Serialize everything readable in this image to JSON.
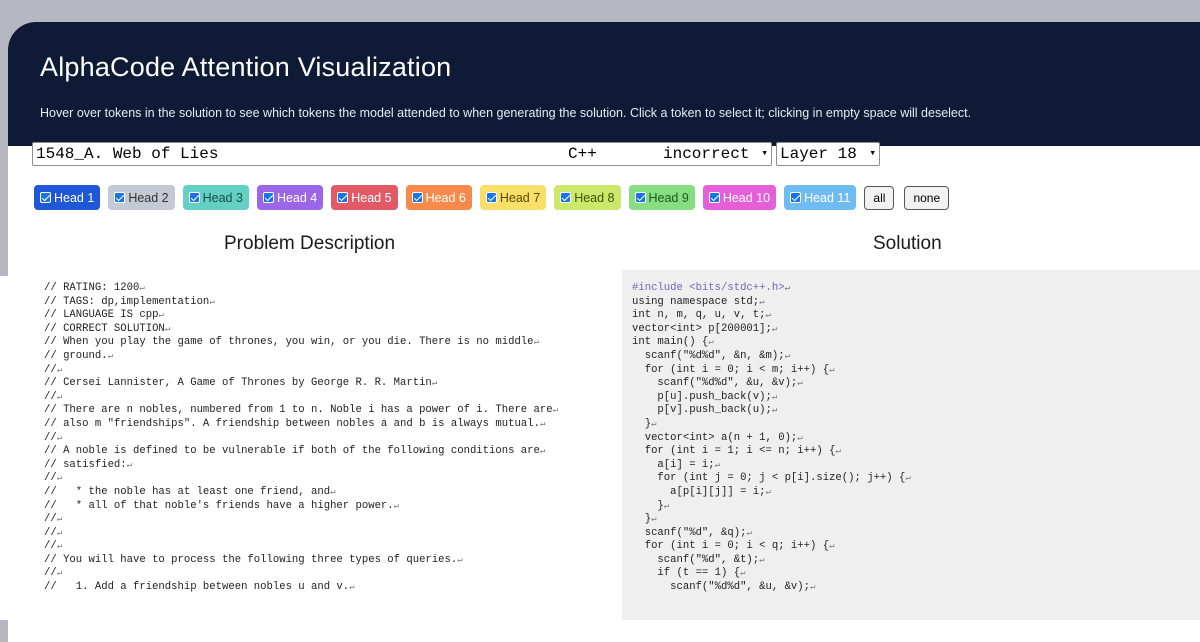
{
  "header": {
    "title": "AlphaCode Attention Visualization",
    "subtitle": "Hover over tokens in the solution to see which tokens the model attended to when generating the solution. Click a token to select it; clicking in empty space will deselect."
  },
  "problem_select": {
    "title": "1548_A. Web of Lies",
    "language": "C++",
    "status": "incorrect"
  },
  "layer_select": {
    "value": "Layer 18"
  },
  "heads": [
    {
      "label": "Head 1",
      "color": "#1f57d6",
      "text_color": "#ffffff"
    },
    {
      "label": "Head 2",
      "color": "#c4c9d4",
      "text_color": "#333333"
    },
    {
      "label": "Head 3",
      "color": "#62d1c4",
      "text_color": "#1a4d47"
    },
    {
      "label": "Head 4",
      "color": "#9b66e8",
      "text_color": "#ffffff"
    },
    {
      "label": "Head 5",
      "color": "#e25a66",
      "text_color": "#ffffff"
    },
    {
      "label": "Head 6",
      "color": "#f7894a",
      "text_color": "#ffffff"
    },
    {
      "label": "Head 7",
      "color": "#f8df6a",
      "text_color": "#5a4c00"
    },
    {
      "label": "Head 8",
      "color": "#cbe86a",
      "text_color": "#3f5200"
    },
    {
      "label": "Head 9",
      "color": "#86dd82",
      "text_color": "#1f5a1c"
    },
    {
      "label": "Head 10",
      "color": "#e65fd8",
      "text_color": "#ffffff"
    },
    {
      "label": "Head 11",
      "color": "#6fbdf0",
      "text_color": "#ffffff"
    }
  ],
  "buttons": {
    "all": "all",
    "none": "none"
  },
  "sections": {
    "problem_title": "Problem Description",
    "solution_title": "Solution"
  },
  "problem_lines": [
    "// RATING: 1200",
    "// TAGS: dp,implementation",
    "// LANGUAGE IS cpp",
    "// CORRECT SOLUTION",
    "// When you play the game of thrones, you win, or you die. There is no middle",
    "// ground.",
    "//",
    "// Cersei Lannister, A Game of Thrones by George R. R. Martin",
    "//",
    "// There are n nobles, numbered from 1 to n. Noble i has a power of i. There are",
    "// also m \"friendships\". A friendship between nobles a and b is always mutual.",
    "//",
    "// A noble is defined to be vulnerable if both of the following conditions are",
    "// satisfied:",
    "//",
    "//   * the noble has at least one friend, and",
    "//   * all of that noble's friends have a higher power.",
    "//",
    "//",
    "//",
    "// You will have to process the following three types of queries.",
    "//",
    "//   1. Add a friendship between nobles u and v."
  ],
  "solution_lines": [
    "#include <bits/stdc++.h>",
    "using namespace std;",
    "int n, m, q, u, v, t;",
    "vector<int> p[200001];",
    "int main() {",
    "  scanf(\"%d%d\", &n, &m);",
    "  for (int i = 0; i < m; i++) {",
    "    scanf(\"%d%d\", &u, &v);",
    "    p[u].push_back(v);",
    "    p[v].push_back(u);",
    "  }",
    "  vector<int> a(n + 1, 0);",
    "  for (int i = 1; i <= n; i++) {",
    "    a[i] = i;",
    "    for (int j = 0; j < p[i].size(); j++) {",
    "      a[p[i][j]] = i;",
    "    }",
    "  }",
    "  scanf(\"%d\", &q);",
    "  for (int i = 0; i < q; i++) {",
    "    scanf(\"%d\", &t);",
    "    if (t == 1) {",
    "      scanf(\"%d%d\", &u, &v);"
  ]
}
